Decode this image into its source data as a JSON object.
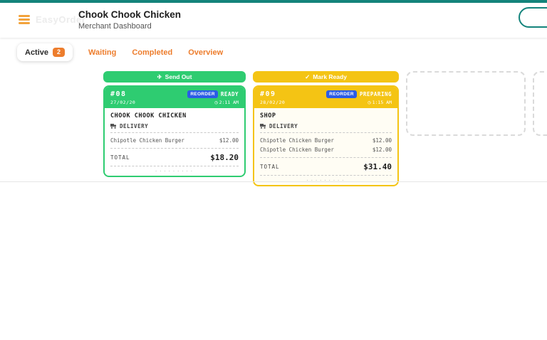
{
  "colors": {
    "topbar": "#14847c",
    "green": "#2ecc71",
    "yellow": "#f4c414",
    "tab_orange": "#ed7d2d",
    "reorder_blue": "#2b5ce6"
  },
  "header": {
    "logo_text": "EasyOrder",
    "title": "Chook Chook Chicken",
    "subtitle": "Merchant Dashboard"
  },
  "tabs": [
    {
      "label": "Active",
      "badge": "2"
    },
    {
      "label": "Waiting"
    },
    {
      "label": "Completed"
    },
    {
      "label": "Overview"
    }
  ],
  "icons": {
    "clock": "◷",
    "send": "✈",
    "ready": "✓"
  },
  "perforation": "·········",
  "orders": [
    {
      "action_label": "Send Out",
      "number": "#08",
      "date": "27/02/20",
      "reorder_badge": "REORDER",
      "status": "READY",
      "time": "2:11 AM",
      "vendor": "CHOOK CHOOK CHICKEN",
      "fulfillment": "DELIVERY",
      "items": [
        {
          "name": "Chipotle Chicken Burger",
          "price": "$12.00"
        }
      ],
      "total_label": "TOTAL",
      "total": "$18.20"
    },
    {
      "action_label": "Mark Ready",
      "number": "#09",
      "date": "28/02/20",
      "reorder_badge": "REORDER",
      "status": "PREPARING",
      "time": "1:15 AM",
      "vendor": "SHOP",
      "fulfillment": "DELIVERY",
      "items": [
        {
          "name": "Chipotle Chicken Burger",
          "price": "$12.00"
        },
        {
          "name": "Chipotle Chicken Burger",
          "price": "$12.00"
        }
      ],
      "total_label": "TOTAL",
      "total": "$31.40"
    }
  ]
}
